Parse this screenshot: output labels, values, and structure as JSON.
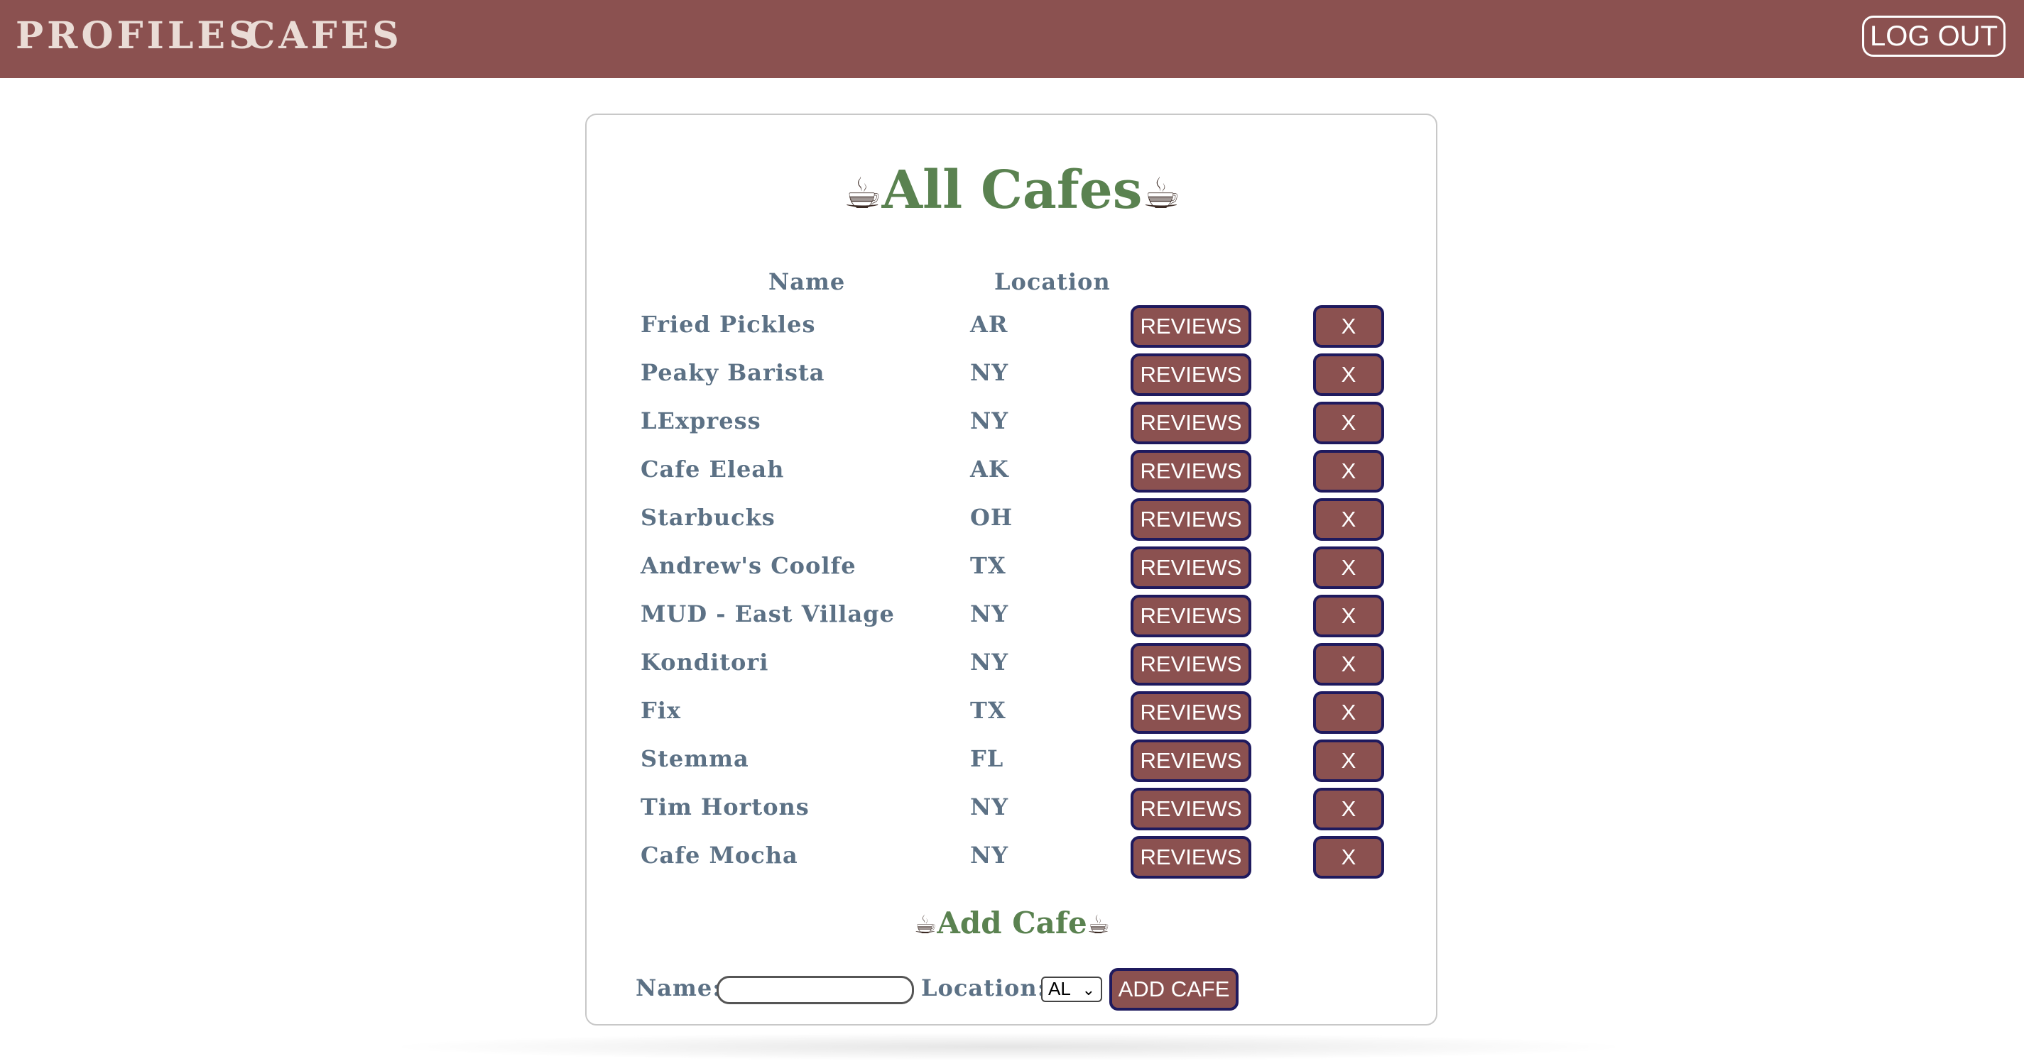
{
  "nav": {
    "profiles_label": "PROFILES",
    "cafes_label": "CAFES",
    "logout_label": "LOG OUT"
  },
  "page": {
    "title": "All Cafes",
    "cup_glyph": "☕"
  },
  "table": {
    "headers": {
      "name": "Name",
      "location": "Location"
    },
    "reviews_label": "REVIEWS",
    "delete_label": "X",
    "rows": [
      {
        "name": "Fried Pickles",
        "location": "AR"
      },
      {
        "name": "Peaky Barista",
        "location": "NY"
      },
      {
        "name": "LExpress",
        "location": "NY"
      },
      {
        "name": "Cafe Eleah",
        "location": "AK"
      },
      {
        "name": "Starbucks",
        "location": "OH"
      },
      {
        "name": "Andrew's Coolfe",
        "location": "TX"
      },
      {
        "name": "MUD - East Village",
        "location": "NY"
      },
      {
        "name": "Konditori",
        "location": "NY"
      },
      {
        "name": "Fix",
        "location": "TX"
      },
      {
        "name": "Stemma",
        "location": "FL"
      },
      {
        "name": "Tim Hortons",
        "location": "NY"
      },
      {
        "name": "Cafe Mocha",
        "location": "NY"
      }
    ]
  },
  "add_form": {
    "title": "Add Cafe",
    "name_label": "Name:",
    "name_value": "",
    "location_label": "Location:",
    "location_selected": "AL",
    "submit_label": "ADD CAFE"
  },
  "colors": {
    "brand": "#8b5150",
    "title_green": "#5a8250",
    "text_slate": "#5c7185",
    "button_border": "#1f1a5e"
  },
  "icons": {
    "cup": "coffee-cup-icon",
    "select_arrow": "chevron-down-icon"
  }
}
